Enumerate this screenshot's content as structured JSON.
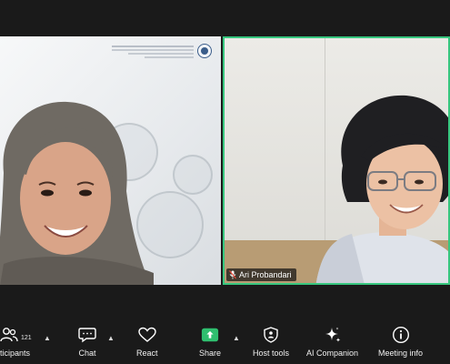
{
  "participants": {
    "right_name": "Ari Probandari"
  },
  "toolbar": {
    "participants_label": "Participants",
    "participants_count": "121",
    "chat_label": "Chat",
    "react_label": "React",
    "share_label": "Share",
    "host_tools_label": "Host tools",
    "ai_companion_label": "AI Companion",
    "meeting_info_label": "Meeting info"
  },
  "colors": {
    "active_speaker_border": "#37c77f",
    "share_green": "#2fbf6f",
    "toolbar_bg": "#1a1a1a"
  }
}
